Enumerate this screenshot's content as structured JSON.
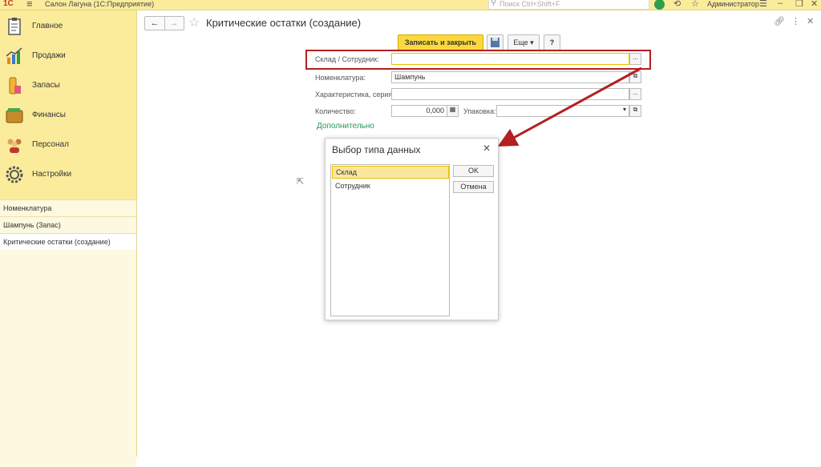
{
  "titlebar": {
    "logo": "1С",
    "app_title": "Салон Лагуна  (1С:Предприятие)",
    "search_placeholder": "Поиск Ctrl+Shift+F",
    "user": "Администратор"
  },
  "sidebar": {
    "items": [
      {
        "label": "Главное",
        "icon": "clipboard-icon"
      },
      {
        "label": "Продажи",
        "icon": "sales-chart-icon"
      },
      {
        "label": "Запасы",
        "icon": "stock-icon"
      },
      {
        "label": "Финансы",
        "icon": "wallet-icon"
      },
      {
        "label": "Персонал",
        "icon": "people-icon"
      },
      {
        "label": "Настройки",
        "icon": "gear-icon"
      }
    ],
    "history": [
      {
        "label": "Номенклатура"
      },
      {
        "label": "Шампунь (Запас)"
      },
      {
        "label": "Критические остатки (создание)"
      }
    ]
  },
  "form": {
    "title": "Критические остатки (создание)",
    "save_close": "Записать и закрыть",
    "more": "Еще",
    "help": "?",
    "fields": {
      "warehouse_employee": {
        "label": "Склад / Сотрудник:",
        "value": ""
      },
      "nomenclature": {
        "label": "Номенклатура:",
        "value": "Шампунь"
      },
      "characteristic": {
        "label": "Характеристика, серия:",
        "value": ""
      },
      "quantity": {
        "label": "Количество:",
        "value": "0,000"
      },
      "package": {
        "label": "Упаковка:",
        "value": ""
      }
    },
    "additional": "Дополнительно"
  },
  "dialog": {
    "title": "Выбор типа данных",
    "options": [
      "Склад",
      "Сотрудник"
    ],
    "selected": "Склад",
    "ok": "OK",
    "cancel": "Отмена"
  },
  "colors": {
    "sidebar": "#fbec9c",
    "accent_button": "#fbd83d",
    "highlight_box": "#b32020",
    "link_green": "#229955"
  }
}
